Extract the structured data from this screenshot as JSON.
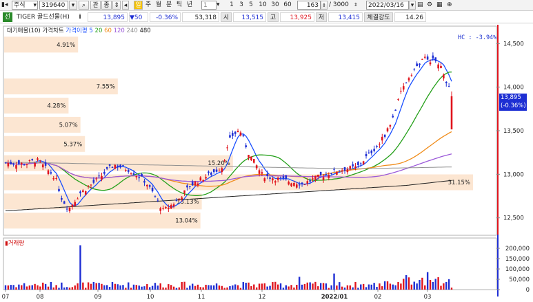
{
  "toolbar": {
    "market_select": "주식",
    "code_input": "319640",
    "related_label": "관",
    "add_label": "종",
    "period_tabs": [
      "주",
      "월",
      "분",
      "틱",
      "년"
    ],
    "interval_input": "1",
    "interval_buttons": [
      "1",
      "3",
      "5",
      "10",
      "30",
      "60"
    ],
    "count_input": "163",
    "max_count": "/ 3000",
    "date_input": "2022/03/16"
  },
  "quote": {
    "name_tag": "선",
    "name": "TIGER 골드선물(H)",
    "price": "13,895",
    "change": "▼50",
    "change_pct": "-0.36%",
    "volume": "53,318",
    "open_label": "시",
    "open": "13,515",
    "high_label": "고",
    "high": "13,925",
    "low_label": "저",
    "low": "13,415",
    "strength_label": "체결강도",
    "strength": "14.26"
  },
  "legend": {
    "main_items": [
      "대기매물(10)",
      "가격차트",
      "가격이평"
    ],
    "ma_periods": [
      "5",
      "20",
      "60",
      "120",
      "240",
      "480"
    ],
    "ma_colors": [
      "#1a4fff",
      "#25a01a",
      "#f08c1a",
      "#9b59d9",
      "#909090",
      "#202020"
    ],
    "volume_title": "거래량"
  },
  "hc_text": "HC :  -3.94%",
  "current_price_tag": [
    "13,895",
    "(-0.36%)"
  ],
  "colors": {
    "up": "#e0141d",
    "down": "#1f2fd4",
    "accent": "#1d2fd3",
    "band": "#fce6d2"
  },
  "chart_data": [
    {
      "type": "candlestick",
      "title": "가격차트",
      "yticks": [
        "14,500",
        "14,000",
        "13,500",
        "13,000",
        "12,500"
      ],
      "ylim": [
        12300,
        14700
      ],
      "x_tick_labels": [
        "07",
        "08",
        "09",
        "10",
        "11",
        "12",
        "2022/01",
        "02",
        "03"
      ],
      "volume_profile": [
        {
          "price": 14480,
          "label": "4.91%"
        },
        {
          "price": 14000,
          "label": "7.55%"
        },
        {
          "price": 13780,
          "label": "4.28%"
        },
        {
          "price": 13560,
          "label": "5.07%"
        },
        {
          "price": 13340,
          "label": "5.37%"
        },
        {
          "price": 13120,
          "label": "15.20%"
        },
        {
          "price": 12900,
          "label": "31.15%"
        },
        {
          "price": 12680,
          "label": "13.13%"
        },
        {
          "price": 12460,
          "label": "13.04%"
        }
      ]
    },
    {
      "type": "bar",
      "title": "거래량",
      "yticks": [
        "200,000",
        "150,000",
        "100,000",
        "50,000",
        "0"
      ],
      "ylim": [
        0,
        250000
      ]
    }
  ]
}
